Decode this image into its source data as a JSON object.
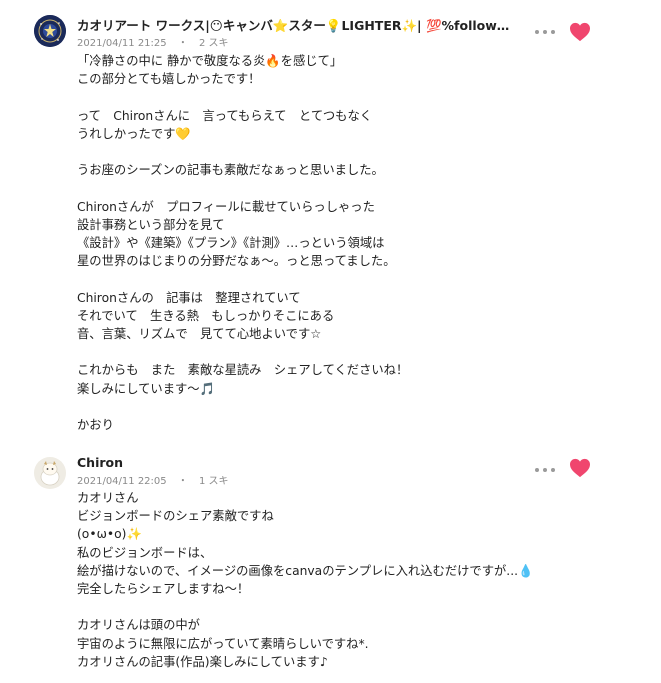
{
  "comments": [
    {
      "author": "カオリアート ワークス|😶キャンバ⭐スター💡LIGHTER✨| 💯%follow ba...",
      "date": "2021/04/11 21:25",
      "sep": "・",
      "likes": "2 スキ",
      "lines": [
        "「冷静さの中に 静かで敬度なる炎🔥を感じて」",
        "この部分とても嬉しかったです！",
        "",
        "って　Chironさんに　言ってもらえて　とてつもなく",
        "うれしかったです💛",
        "",
        "うお座のシーズンの記事も素敵だなぁっと思いました。",
        "",
        "Chironさんが　プロフィールに載せていらっしゃった",
        "設計事務という部分を見て",
        "《設計》や《建築》《プラン》《計測》…っという領域は",
        "星の世界のはじまりの分野だなぁ〜。っと思ってました。",
        "",
        "Chironさんの　記事は　整理されていて",
        "それでいて　生きる熱　もしっかりそこにある",
        "音、言葉、リズムで　見てて心地よいです☆",
        "",
        "これからも　また　素敵な星読み　シェアしてくださいね！",
        "楽しみにしています〜🎵",
        "",
        "かおり"
      ]
    },
    {
      "author": "Chiron",
      "date": "2021/04/11 22:05",
      "sep": "・",
      "likes": "1 スキ",
      "lines": [
        "カオリさん",
        "ビジョンボードのシェア素敵ですね",
        "(o•ω•o)✨",
        "私のビジョンボードは、",
        "絵が描けないので、イメージの画像をcanvaのテンプレに入れ込むだけですが...💧",
        "完全したらシェアしますね〜！",
        "",
        "カオリさんは頭の中が",
        "宇宙のように無限に広がっていて素晴らしいですね*.",
        "カオリさんの記事(作品)楽しみにしています♪"
      ]
    }
  ],
  "icons": {
    "avatar1": "starry-circle-avatar",
    "avatar2": "character-avatar",
    "more": "more-horizontal-icon",
    "like": "heart-icon"
  },
  "colors": {
    "heart": "#f0466e",
    "meta": "#8a8a8a",
    "text": "#222222"
  }
}
